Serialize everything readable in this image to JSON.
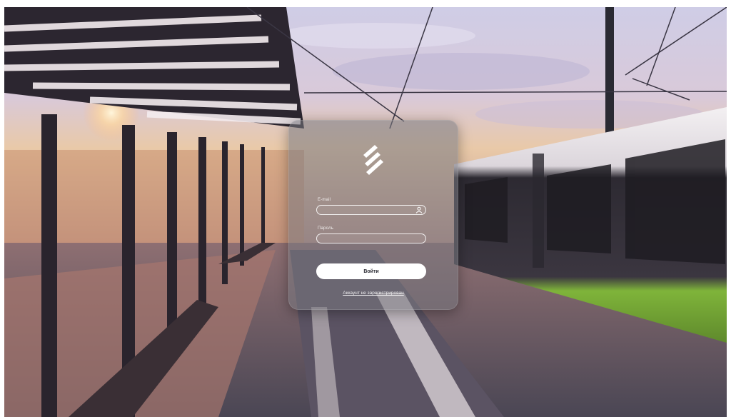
{
  "login": {
    "email_label": "E-mail",
    "email_value": "",
    "password_label": "Пароль",
    "password_value": "",
    "submit_label": "Войти",
    "register_link": "Аккаунт не зарегистрирован"
  },
  "colors": {
    "card_background": "#78787f",
    "button_background": "#ffffff",
    "button_text": "#2b2b33",
    "tram_green": "#7fb43a"
  },
  "icons": {
    "logo": "brand-logo-icon",
    "email_field": "user-icon"
  }
}
